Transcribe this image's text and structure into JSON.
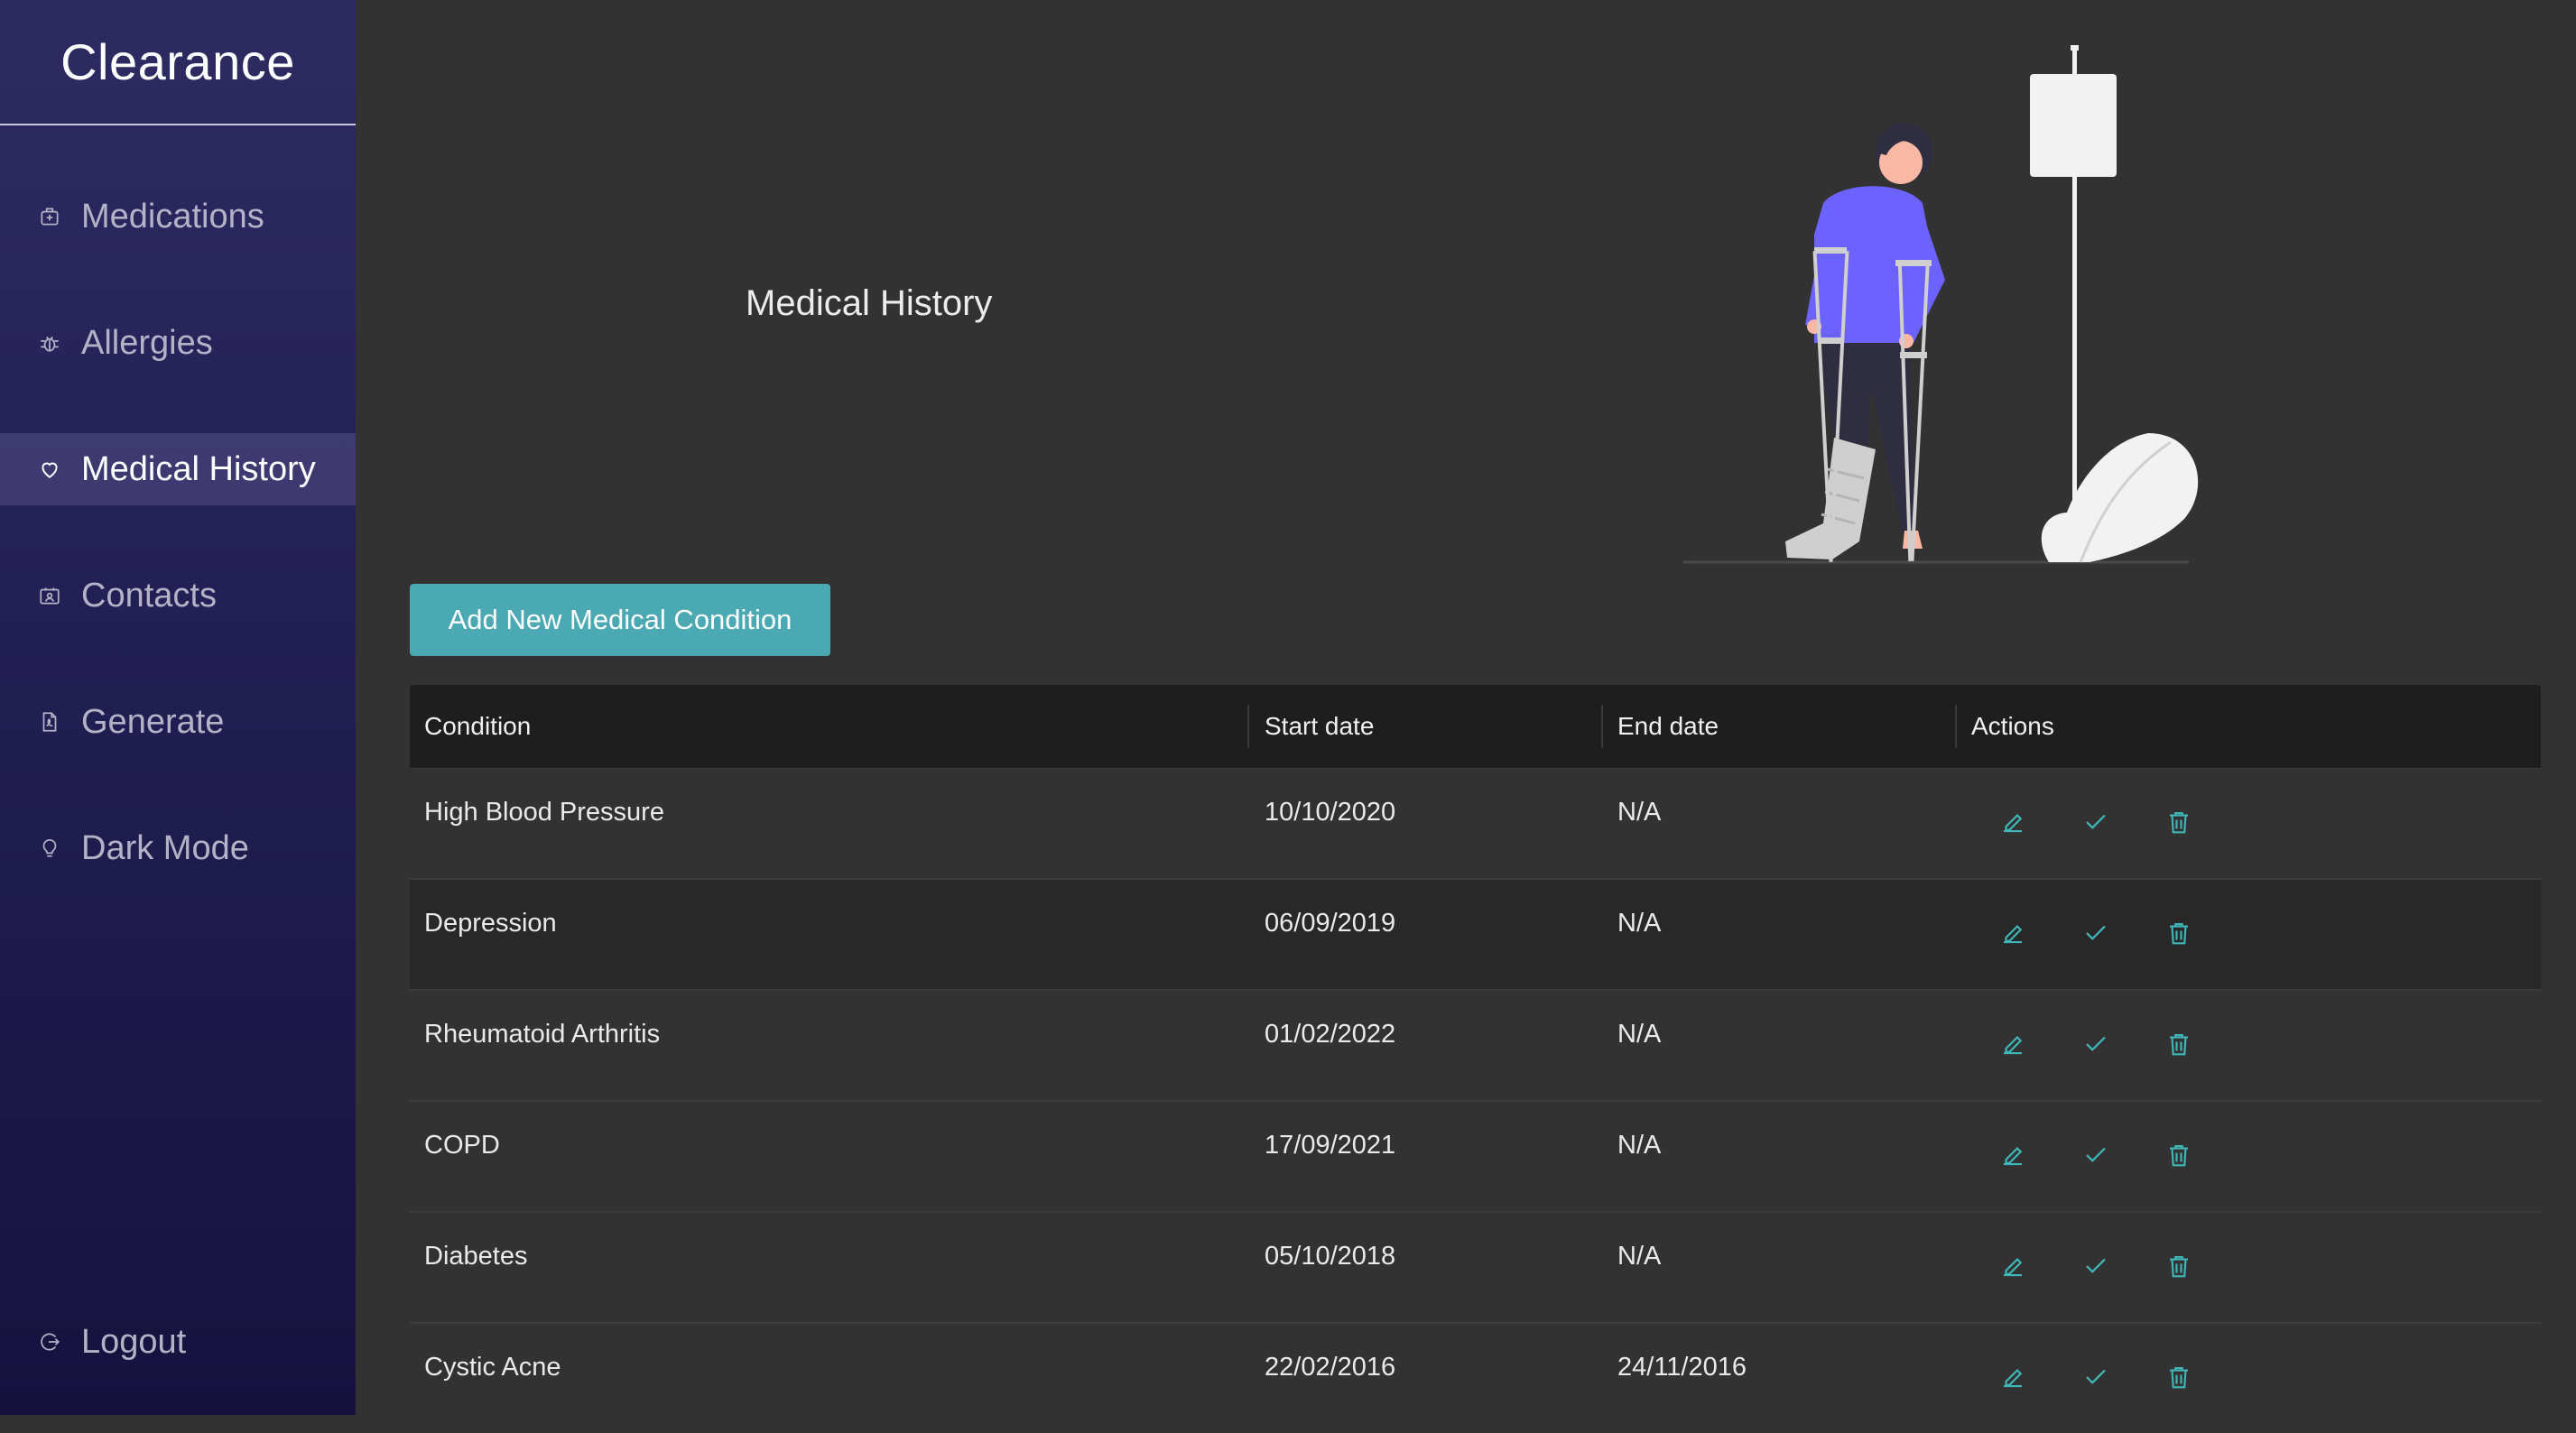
{
  "app": {
    "name": "Clearance"
  },
  "sidebar": {
    "items": [
      {
        "label": "Medications",
        "icon": "medkit-icon"
      },
      {
        "label": "Allergies",
        "icon": "bug-icon"
      },
      {
        "label": "Medical History",
        "icon": "heart-icon",
        "active": true
      },
      {
        "label": "Contacts",
        "icon": "contact-card-icon"
      },
      {
        "label": "Generate",
        "icon": "pdf-file-icon"
      },
      {
        "label": "Dark Mode",
        "icon": "lightbulb-icon"
      }
    ],
    "logout": {
      "label": "Logout",
      "icon": "logout-icon"
    }
  },
  "main": {
    "title": "Medical History",
    "add_button": "Add New Medical Condition",
    "table": {
      "columns": [
        "Condition",
        "Start date",
        "End date",
        "Actions"
      ],
      "rows": [
        {
          "condition": "High Blood Pressure",
          "start": "10/10/2020",
          "end": "N/A"
        },
        {
          "condition": "Depression",
          "start": "06/09/2019",
          "end": "N/A"
        },
        {
          "condition": "Rheumatoid Arthritis",
          "start": "01/02/2022",
          "end": "N/A"
        },
        {
          "condition": "COPD",
          "start": "17/09/2021",
          "end": "N/A"
        },
        {
          "condition": "Diabetes",
          "start": "05/10/2018",
          "end": "N/A"
        },
        {
          "condition": "Cystic Acne",
          "start": "22/02/2016",
          "end": "24/11/2016"
        }
      ],
      "row_actions": [
        "edit-icon",
        "check-icon",
        "trash-icon"
      ]
    }
  },
  "colors": {
    "accent": "#4aa9b2",
    "icon_teal": "#3fb8ba",
    "sidebar_top": "#2e2b63",
    "sidebar_bottom": "#16123e",
    "background": "#323232",
    "illustration_purple": "#6c63ff"
  }
}
